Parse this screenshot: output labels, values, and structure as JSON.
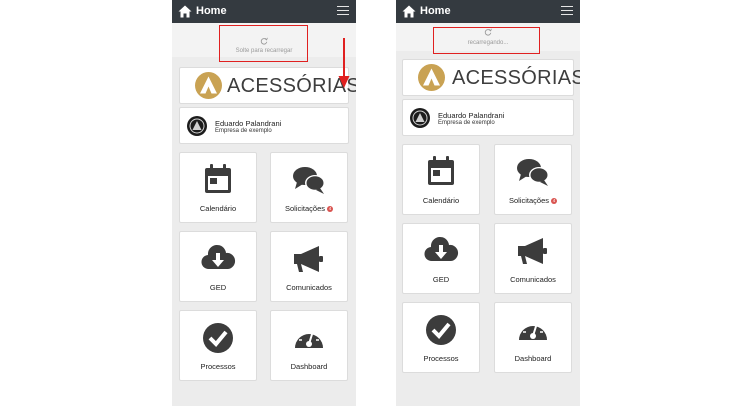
{
  "colors": {
    "navbar": "#343a40",
    "icon": "#3c3c3c",
    "gold": "#c9a253",
    "badge": "#d9534f",
    "annotation": "#e02020"
  },
  "screens": [
    {
      "navbar": {
        "title": "Home",
        "home_icon": "home-icon",
        "menu_icon": "hamburger-menu-icon"
      },
      "pull_to_refresh": {
        "text": "Solte para recarregar",
        "icon": "refresh-icon"
      },
      "logo": {
        "text": "ACESSÓRIAS"
      },
      "user": {
        "name": "Eduardo Palandrani",
        "company": "Empresa de exemplo"
      },
      "tiles": [
        {
          "label": "Calendário",
          "icon": "calendar-icon"
        },
        {
          "label": "Solicitações",
          "icon": "chat-bubbles-icon",
          "badge": "4"
        },
        {
          "label": "GED",
          "icon": "cloud-download-icon"
        },
        {
          "label": "Comunicados",
          "icon": "megaphone-icon"
        },
        {
          "label": "Processos",
          "icon": "check-circle-icon"
        },
        {
          "label": "Dashboard",
          "icon": "gauge-icon"
        }
      ]
    },
    {
      "navbar": {
        "title": "Home",
        "home_icon": "home-icon",
        "menu_icon": "hamburger-menu-icon"
      },
      "pull_to_refresh": {
        "text": "recarregando...",
        "icon": "refresh-icon"
      },
      "logo": {
        "text": "ACESSÓRIAS"
      },
      "user": {
        "name": "Eduardo Palandrani",
        "company": "Empresa de exemplo"
      },
      "tiles": [
        {
          "label": "Calendário",
          "icon": "calendar-icon"
        },
        {
          "label": "Solicitações",
          "icon": "chat-bubbles-icon",
          "badge": "4"
        },
        {
          "label": "GED",
          "icon": "cloud-download-icon"
        },
        {
          "label": "Comunicados",
          "icon": "megaphone-icon"
        },
        {
          "label": "Processos",
          "icon": "check-circle-icon"
        },
        {
          "label": "Dashboard",
          "icon": "gauge-icon"
        }
      ]
    }
  ]
}
